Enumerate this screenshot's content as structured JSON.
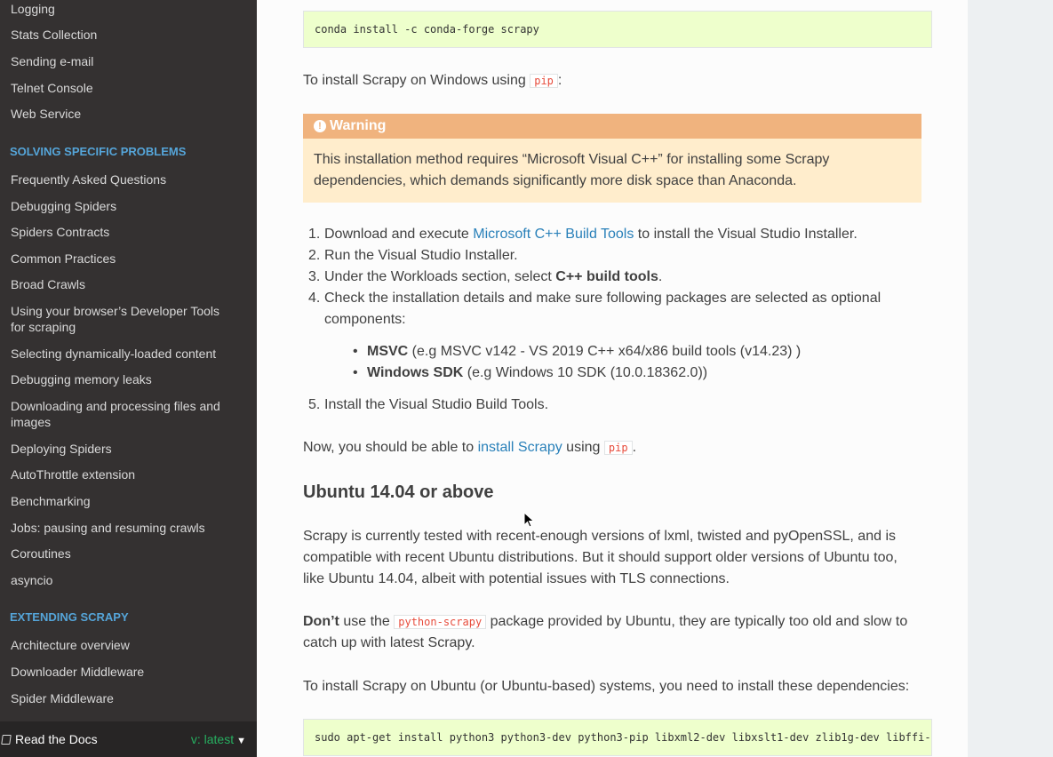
{
  "sidebar": {
    "top_links": [
      "Logging",
      "Stats Collection",
      "Sending e-mail",
      "Telnet Console",
      "Web Service"
    ],
    "section1": {
      "caption": "SOLVING SPECIFIC PROBLEMS",
      "links": [
        "Frequently Asked Questions",
        "Debugging Spiders",
        "Spiders Contracts",
        "Common Practices",
        "Broad Crawls",
        "Using your browser’s Developer Tools for scraping",
        "Selecting dynamically-loaded content",
        "Debugging memory leaks",
        "Downloading and processing files and images",
        "Deploying Spiders",
        "AutoThrottle extension",
        "Benchmarking",
        "Jobs: pausing and resuming crawls",
        "Coroutines",
        "asyncio"
      ]
    },
    "section2": {
      "caption": "EXTENDING SCRAPY",
      "links": [
        "Architecture overview",
        "Downloader Middleware",
        "Spider Middleware"
      ]
    },
    "rtd": {
      "label": "Read the Docs",
      "version": "v: latest"
    }
  },
  "main": {
    "code1": "conda install -c conda-forge scrapy",
    "windows_intro": {
      "before": "To install Scrapy on Windows using ",
      "code": "pip",
      "after": ":"
    },
    "warning": {
      "title": "Warning",
      "body": "This installation method requires “Microsoft Visual C++” for installing some Scrapy dependencies, which demands significantly more disk space than Anaconda."
    },
    "steps": {
      "s1": {
        "num": "1.",
        "before": "Download and execute ",
        "link": "Microsoft C++ Build Tools",
        "after": " to install the Visual Studio Installer."
      },
      "s2": {
        "num": "2.",
        "text": "Run the Visual Studio Installer."
      },
      "s3": {
        "num": "3.",
        "before": "Under the Workloads section, select ",
        "bold": "C++ build tools",
        "after": "."
      },
      "s4": {
        "num": "4.",
        "text": "Check the installation details and make sure following packages are selected as optional components:"
      },
      "sub1": {
        "bold": "MSVC",
        "text": " (e.g MSVC v142 - VS 2019 C++ x64/x86 build tools (v14.23) )"
      },
      "sub2": {
        "bold": "Windows SDK",
        "text": " (e.g Windows 10 SDK (10.0.18362.0))"
      },
      "s5": {
        "num": "5.",
        "text": "Install the Visual Studio Build Tools."
      }
    },
    "now_para": {
      "before": "Now, you should be able to ",
      "link": "install Scrapy",
      "middle": " using ",
      "code": "pip",
      "after": "."
    },
    "heading": "Ubuntu 14.04 or above",
    "ubuntu_para": "Scrapy is currently tested with recent-enough versions of lxml, twisted and pyOpenSSL, and is compatible with recent Ubuntu distributions. But it should support older versions of Ubuntu too, like Ubuntu 14.04, albeit with potential issues with TLS connections.",
    "dont_para": {
      "bold": "Don’t",
      "before": " use the ",
      "code": "python-scrapy",
      "after": " package provided by Ubuntu, they are typically too old and slow to catch up with latest Scrapy."
    },
    "deps_para": "To install Scrapy on Ubuntu (or Ubuntu-based) systems, you need to install these dependencies:",
    "code2": "sudo apt-get install python3 python3-dev python3-pip libxml2-dev libxslt1-dev zlib1g-dev libffi-dev libssl-dev"
  },
  "colors": {
    "sidebar_bg": "#343131",
    "caption": "#55a5d9",
    "link": "#2980b9",
    "warning_title_bg": "#f0b37e",
    "warning_body_bg": "#ffedcc",
    "code_bg": "#eeffcc",
    "inline_code": "#e74c3c",
    "version": "#27ae60"
  },
  "icons": [
    "warning-icon",
    "book-icon",
    "caret-down-icon"
  ]
}
